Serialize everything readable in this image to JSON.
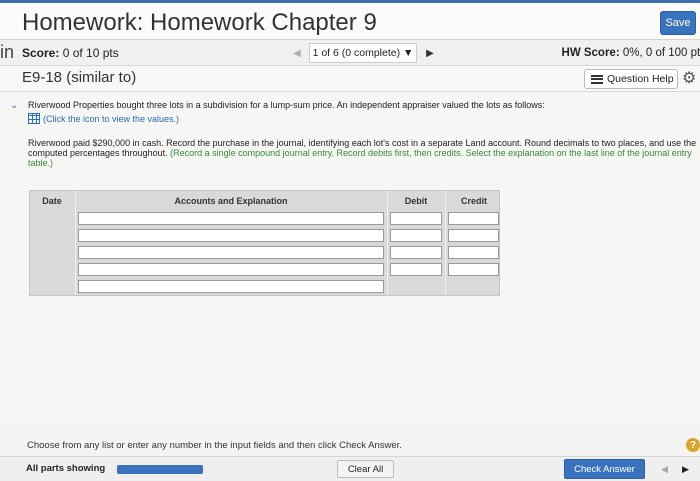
{
  "header": {
    "title": "Homework: Homework Chapter 9",
    "save_label": "Save"
  },
  "scorebar": {
    "left_cut": "in",
    "score_label": "Score:",
    "score_value": "0 of 10 pts",
    "nav_text": "1 of 6 (0 complete) ▼",
    "hw_score_label": "HW Score:",
    "hw_score_value": "0%, 0 of 100 pts"
  },
  "exercise": {
    "title": "E9-18 (similar to)",
    "question_help_label": "Question Help"
  },
  "problem": {
    "intro": "Riverwood Properties bought three lots in a subdivision for a lump-sum price. An independent appraiser valued the lots as follows:",
    "icon_link": "(Click the icon to view the values.)",
    "instruction_main": "Riverwood paid $290,000 in cash. Record the purchase in the journal, identifying each lot's cost in a separate Land account. Round decimals to two places, and use the computed percentages throughout.",
    "instruction_green": "(Record a single compound journal entry. Record debits first, then credits. Select the explanation on the last line of the journal entry table.)"
  },
  "journal": {
    "headers": [
      "Date",
      "Accounts and Explanation",
      "Debit",
      "Credit"
    ],
    "rows": [
      {
        "account": "",
        "debit": "",
        "credit": ""
      },
      {
        "account": "",
        "debit": "",
        "credit": ""
      },
      {
        "account": "",
        "debit": "",
        "credit": ""
      },
      {
        "account": "",
        "debit": "",
        "credit": ""
      },
      {
        "account": ""
      }
    ]
  },
  "footer": {
    "instruction": "Choose from any list or enter any number in the input fields and then click Check Answer.",
    "all_parts_label": "All parts showing",
    "clear_all_label": "Clear All",
    "check_answer_label": "Check Answer",
    "help_glyph": "?"
  },
  "icons": {
    "prev": "triangle-left-icon",
    "next": "triangle-right-icon",
    "gear": "gear-icon",
    "question_help": "list-icon",
    "table": "table-icon"
  },
  "colors": {
    "accent": "#3a73bd",
    "green_text": "#3a8a3a",
    "help_badge": "#d8a42a"
  }
}
